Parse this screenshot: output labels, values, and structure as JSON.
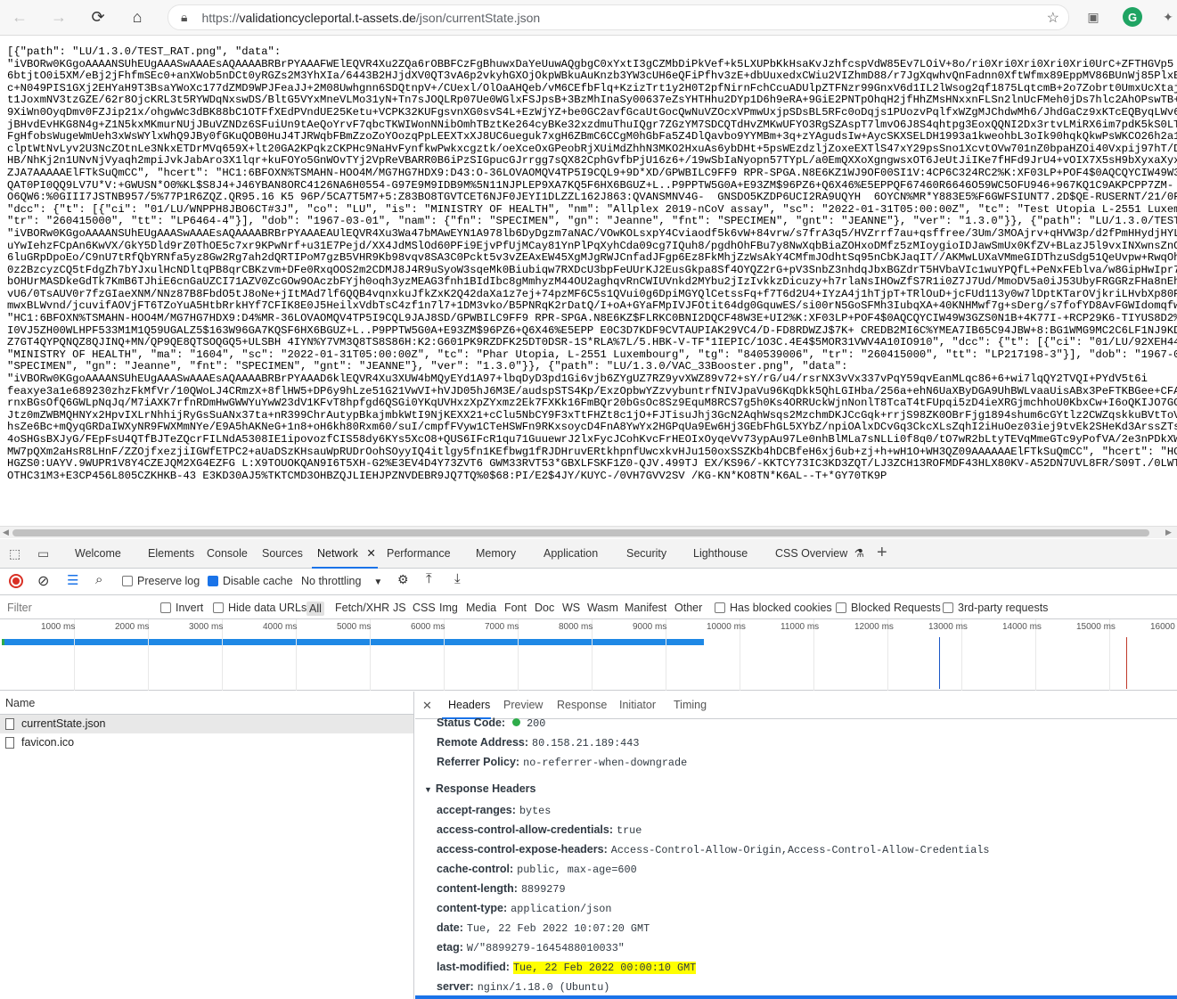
{
  "browser": {
    "url_prefix": "https://",
    "url_host": "validationcycleportal.t-assets.de",
    "url_path": "/json/currentState.json",
    "back_icon": "arrow-left-icon",
    "forward_icon": "arrow-right-icon",
    "reload_icon": "reload-icon",
    "home_icon": "home-icon"
  },
  "json_lines": [
    "[{\"path\": \"LU/1.3.0/TEST_RAT.png\", \"data\":",
    "\"iVBORw0KGgoAAAANSUhEUgAAASwAAAEsAQAAAABRBrPYAAAFWElEQVR4Xu2ZQa6rOBBFCzFgBhuwxDaYeUuwAQgbgC0xYxtI3gCZMbDiPkVef+k5LXUPbKkHsaKvJzhfcspVdW85Ev7LOiV+8o/ri0Xri0Xri0Xri0Xri0UrC+ZFTHGVp5",
    "6btjtO0i5XM/eBj2jFhfmSEc0+anXWob5nDCt0yRGZs2M3YhXIa/6443B2HJjdXV0QT3vA6p2vkyhGXOjOkpWBkuAuKnzb3YW3cUH6eQFiPfhv3zE+dbUuxedxCWiu2VIZhmD88/r7JgXqwhvQnFadnn0XftWfmx89EppMV86BUnWj85PlxEhAQj",
    "c+N049PIS1GXj2EHYaH9T3BsaYWoXc177dZMD9WPJFeaJJ+2M08Uwhgnn6SDQtnpV+/CUexl/OlOaAHQeb/vM6CEfbFlq+KzizTrt1y2H0T2pfNirnFchCcuADUlpZTFNzr99GnxV6d1IL2lWsog2qf1875LqtcmB+2o7Zobrt0UmxUcXtajh5J",
    "t1JoxmNV3tzGZE/62r8OjcKRL3t5RYWDqNxswDS/BltG5VYxMneVLMo31yN+Tn7sJOQLRp07Ue0WGlxFSJpsB+3BzMhInaSy00637eZsYHTHhu2DYp1D6h9eRA+9GiE2PNTpOhqH2jfHhZMsHNxxnFLSn2lnUcFMeh0jDs7hlc2AhOPswTB+lUCD",
    "9XiWn0OyqDmv0FZJip21x/ohgwWc3dBK88bC1OTFfXEdPVndUE25Ketu+VCPK32KUFgsvnXG0svS4L+EzWjYZ+be0GC2avfGcaUtGocQwNuVZOcxVPmwUxjpSDsBL5RFc0oDqjs1PUozvPqlfxWZgMJChdwMh6/JhdGaCz9xKTcEQByqLWv6o+q",
    "jBHvdEvHKG8N4g+Z1N5kxMKmurNUjJBuVZNDz6SFuiUn9tAeQoYrvF7qbcTKWIWonNNibOmhTBztKe264cyBKe32xzdmuThuIQgr7ZGzYM7SDCQTdHvZMKwUFYO3RgSZAspT7lmvO6J8S4qhtpg3EoxQQNI2Dx3rtvLMiRX6im7pdK5kS0LTDss",
    "FgHfobsWugeWmUeh3xWsWYlxWhQ9JBy0fGKuQOB0HuJ4TJRWqbFBmZzoZoYOozqPpLEEXTxXJ8UC6ueguk7xgH6ZBmC6CCgM0hGbFa5Z4DlQavbo9YYMBm+3q+zYAgudsIw+AycSKXSELDH1993a1kweohbL3oIk90hqkQkwPsWKCO26h2a1zuQ",
    "clptWtNvLyv2U3NcZOtnLe3NkxETDrMVq659X+lt20GA2KPqkzCKPHc9NaHvFynfkwPwkxcgztk/oeXceOxGPeobRjXUiMdZhhN3MKO2HxuAs6ybDHt+5psWEzdzljZoxeEXTlS47xY29psSno1XcvtOVw701nZ0bpaHZOi40Vxpij97hT/D+n0H",
    "HB/NhKj2n1UNvNjVyaqh2mpiJvkJabAro3X1lqr+kuFOYo5GnWOvTYj2VpReVBARR0B6iPzSIGpucGJrrgg7sQX82CphGvfbPjU16z6+/19wSbIaNyopn57TYpL/a0EmQXXoXgngwsxOT6JeUtJiIKe7fHFd9JrU4+vOIX7X5sH9bXyxaXyxaXyx",
    "ZJA7AAAAAElFTkSuQmCC\", \"hcert\": \"HC1:6BFOXN%TSMAHN-HOO4M/MG7HG7HDX9:D43:O-36LOVAOMQV4TP5I9CQL9+9D*XD/GPWBILC9FF9 RPR-SPGA.N8E6KZ1WJ9OF00SI1V:4CP6C324RC2%K:XF03LP+POF4$0AQCQYCIW49W3GZS0",
    "QAT0PI0QQ9LV7U*V:+GWUSN*O0%KL$S8J4+J46YBAN8ORC4126NA6H0554-G97E9M9IDB9M%5N11NJPLEP9XA7KQ5F6HX6BGUZ+L..P9PPTW5G0A+E93ZM$96PZ6+Q6X46%E5EPPQF67460R6646O59WC5OFU946+967KQ1C9AKPCPP7ZM-",
    "O6QW6:%0GIII7JSTNB957/5%77P1R6ZQZ.QR95.16 K5 96P/5CA7T5M7+5:Z83BO8TGVTCET6NJF0JEYI1DLZZL162J863:QVANSMNV4G-  GNSDO5KZDP6UCI2RA9UQYH  6OYCN%MR*Y883E5%F6GWFSIUNT7.2D$QE-RUSERNT/21/0FL6O-1",
    "\"dcc\": {\"t\": [{\"ci\": \"01/LU/WNPPH8JBO6CT#3J\", \"co\": \"LU\", \"is\": \"MINISTRY OF HEALTH\", \"nm\": \"Allplex 2019-nCoV assay\", \"sc\": \"2022-01-31T05:00:00Z\", \"tc\": \"Test Utopia L-2551 Luxembour",
    "\"tr\": \"260415000\", \"tt\": \"LP6464-4\"}], \"dob\": \"1967-03-01\", \"nam\": {\"fn\": \"SPECIMEN\", \"gn\": \"Jeanne\", \"fnt\": \"SPECIMEN\", \"gnt\": \"JEANNE\"}, \"ver\": \"1.3.0\"}}, {\"path\": \"LU/1.3.0/TEST_NA",
    "\"iVBORw0KGgoAAAANSUhEUgAAASwAAAEsAQAAAABRBrPYAAAEAUlEQVR4Xu3Wa47bMAwEYN1A978lb6DyDgzm7aNAC/VOwKOLsxpY4Cviaodf5k6vW+84vrw/s7frA3q5/HVZrrf7au+qsffree/3Um/3MOAjrv+qHVW3p/d2fPmHHydjHYLV6cy+",
    "uYwIehzFCpAn6KwVX/GkY5Dld9rZ0ThOE5c7xr9KPwNrf+u31E7Pejd/XX4JdMSlOd60PFi9EjvPfUjMCay81YnPlPqXyhCda09cg7IQuh8/pgdhOhFBu7y8NwXqbBiaZOHxoDMfz5zMIoygioIDJawSmUx0KfZV+BLazJ5l9vxINXwnsZnOMtri",
    "6luGRpDpoEo/C9nU7tRfQbYRNfa5yz8Gw2Rg7ah2dQRTIPoM7gzB5VHR9Kb98vqv8SA3C0Pckt5v3vZEAxEW45XgMJgRWJCnfadJFgp6Ez8FkMhjZzWsAkY4CMfmJOdhtSq95nCbKJaqIT//AKMwLUXaVMmeGIDThzuSdg51QeUvpw+RwqOhyXyf",
    "0z2BzcyzCQ5tFdgZh7bYJxulHcNDltqPB8qrCBKzvm+DFe0RxqOOS2m2CDMJ8J4R9uSyoW3sqeMk0Biubiqw7RXDcU3bpFeUUrKJ2EusGkpa8Sf4OYQZ2rG+pV3SnbZ3nhdqJbxBGZdrT5HVbaVIc1wuYPQfL+PeNxFEblva/w8GipHwIpr7WbPO",
    "bOHUrMASDkeGdTk7KmB6TJhiE6cnGaUZCI71AZV0ZcGOw9OAczbFYjh0oqh3yzMEAG3fnh1BIdIbc8gMmhyzM44OU2aghqvRnCWIUVnkd2MYbu2jIzIvkkzDicuzy+h7rlaNsIHOwZfS7R1i0Z7J7Ud/MmoDV5a0iJ53UbyFRGGRzFHa8nEhupAU",
    "vU6/0TsAUV0r7fzGIaeXNM/NNz87B8FbdO5tJ8oNe+jItMAd7lf6QQB4vqnxkuJfkZxK2Q42daXa1z7ej+74pzMF6C5s1QVui0g6DpiMGYQlCetssFq+f7T6d2U4+IYzA4j1hTjpT+TRlOuD+jcFUd113y0w7lDptKTarOVjkriLHvbXp80Pni3t",
    "mwxBLWvnd/jcuvifAOVjFT6TZoYuA5HtbRrkHYf7CFIK8E0J5HeilxVdbTsC4zf1n7l7+1DM3vko/B5PNRqK2rDatQ/I+oA+GYaFMpIVJFOtit64dg0GquwES/si00rN5GoSFMh3IubqXA+40KNHMwf7g+sDerg/s7fofYD8AvFGWIdomqfwAAAA",
    "\"HC1:6BFOXN%TSMAHN-HOO4M/MG7HG7HDX9:D4%MR-36LOVAOMQV4TP5I9CQL9JAJ8SD/GPWBILC9FF9 RPR-SPGA.N8E6KZ$FLRKC0BNI2DQCF48W3E+UI2%K:XF03LP+POF4$0AQCQYCIW49W3GZS0N1B+4K77I-+RCP29K6-TIYUS8D2%H08L",
    "I0VJ5ZH00WLHPF533M1M1Q59UGALZ5$163W96GA7KQSF6HX6BGUZ+L..P9PPTW5G0A+E93ZM$96PZ6+Q6X46%E5EPP E0C3D7KDF9CVTAUPIAK29VC4/D-FD8RDWZJ$7K+ CREDB2MI6C%YMEA7IB65C94JBW+8:BG1WMG9MC2C6LF1NJ9KD%-BPK",
    "Z7GT4QYPQNQZ8QJINQ+MN/QP9QE8QTSOQGQ5+ULSBH 4IYN%Y7VM3Q8TS8S86H:K2:G601PK9RZDFK25DT0DSR-1S*RLA%7L/5.HBK-V-TF*1IEPIC/1O3C.4E4$5MOR31VWV4A10IO910\", \"dcc\": {\"t\": [{\"ci\": \"01/LU/92XEH4438Q8",
    "\"MINISTRY OF HEALTH\", \"ma\": \"1604\", \"sc\": \"2022-01-31T05:00:00Z\", \"tc\": \"Phar Utopia, L-2551 Luxembourg\", \"tg\": \"840539006\", \"tr\": \"260415000\", \"tt\": \"LP217198-3\"}], \"dob\": \"1967-03-01",
    "\"SPECIMEN\", \"gn\": \"Jeanne\", \"fnt\": \"SPECIMEN\", \"gnt\": \"JEANNE\"}, \"ver\": \"1.3.0\"}}, {\"path\": \"LU/1.3.0/VAC_33Booster.png\", \"data\":",
    "\"iVBORw0KGgoAAAANSUhEUgAAASwAAAEsAQAAAABRBrPYAAAD6klEQVR4Xu3XUW4bMQyEYd1A97+lbqDyD3pd1Gi6vjb6ZYgUZ7RZ9yvXWZ89v72+sY/rG/u4/rsrNX3vVx337vPqY59qvEanMLqc86+6+wi7lqQY2TVQI+PYdV5t6i",
    "feaxye3a1e689230zhzFkMfVr/10QWoLJ4CRmzX+8flHW5+DP6y9hLze51G21VwVI+hVJD05hJ6M3E/audspSTS4Kp/ExzOpbwYZzvybuntrfNIVJpaVu96KqDkk5QhLGIHba/256a+ehN6UaXByDGA9UhBWLvaaUisABx3PeFTKBGee+CFAjjk2",
    "rnxBGsOfQ6GWLpNqJq/M7iAXK7rfnRDmHwGWWYuYwW23dV1KFvT8hpfgd6QSGi0YKqUVHxzXpZYxmz2Ek7FXKk16FmBQr20bGsOc8Sz9EquM8RCS7g5h0Ks4ORRUckWjnNonlT8TcaT4tFUpqi5zD4ieXRGjmchhoU0KbxCw+I6oQKIJO7GGOo5h",
    "Jtz0mZWBMQHNYx2HpvIXLrNhhijRyGsSuANx37ta+nR399ChrAutypBkajmbkWtI9NjKEXX21+cClu5NbCY9F3xTtFHZt8c1jO+FJTisuJhj3GcN2AqhWsqs2MzchmDKJCcGqk+rrjS98ZK0OBrFjg1894shum6cGYtlz2CWZqskkuBVtToVB0C",
    "hsZe6Bc+mQyqGRDaIWXyNR9FWXMmNYe/E9A5hAKNeG+1n8+oH6kh80Rxm60/suI/cmpfFVyw1CTeHSWFn9RKxsoycD4FnA8YwYx2HGPqUa9Ew6Hj3GEbFhGL5XYbZ/npiOAlxDCvGq3CkcXLsZqhI2iHuOez03iej9tvEk2SHeKd3ArssZTsmPN",
    "4oSHGsBXJyG/FEpFsU4QTfBJTeZQcrFILNdA5308IE1ipovozfCIS58dy6KYs5XcO8+QUS6IFcR1qu71GuuewrJ2lxFycJCohKvcFrHEOIxOyqeVv73ypAu97Le0nhBlMLa7sNLLi0f8q0/tO7wR2bLtyTEVqMmeGTc9yPofVA/2e3nPDkXW82cN",
    "MW7pQXm2aHsR8LHnF/ZZOjfxezjiIGWfETPC2+aUaDSzKHsauWpRUDrOohSOyyIQ4itlgy5fn1KEfbwg1fRJDHruvERtkhpnfUwcxkvHJu150oxSSZKb4hDCBfeH6xj6ub+zj+h+wH1O+WH3QZ09AAAAAAElFTkSuQmCC\", \"hcert\": \"HC1:6B",
    "HGZS0:UAYV.9WUPR1V8Y4CZEJQM2XG4EZFG L:X9TOUOKQAN9I6T5XH-G2%E3EV4D4Y73ZVT6 GWM33RVT53*GBXLFSKF1Z0-QJV.499TJ EX/KS96/-KKTCY73IC3KD3ZQT/LJ3ZCH13ROFMDF43HLX80KV-A52DN7UVL8FR/S09T./0LWTKD3",
    "OTHC31M3+E3CP456L805CZKHKB-43 E3KD30AJ5%TKTCMD3OHBZQJLIEHJPZNVDEBR9JQ7TQ%0$68:PI/E2$4JY/KUYC-/0VH7GVV2SV /KG-KN*KO8TN*K6AL--T+*GY70TK9P"
  ],
  "devtools": {
    "tabs": [
      "Welcome",
      "Elements",
      "Console",
      "Sources",
      "Network",
      "Performance",
      "Memory",
      "Application",
      "Security",
      "Lighthouse",
      "CSS Overview"
    ],
    "active_tab": "Network",
    "toolbar": {
      "preserve_log": "Preserve log",
      "disable_cache": "Disable cache",
      "throttling": "No throttling"
    },
    "filter": {
      "placeholder": "Filter",
      "invert": "Invert",
      "hide_data_urls": "Hide data URLs",
      "types": [
        "All",
        "Fetch/XHR",
        "JS",
        "CSS",
        "Img",
        "Media",
        "Font",
        "Doc",
        "WS",
        "Wasm",
        "Manifest",
        "Other"
      ],
      "has_blocked_cookies": "Has blocked cookies",
      "blocked_requests": "Blocked Requests",
      "third_party": "3rd-party requests"
    },
    "timeline_ticks": [
      "1000 ms",
      "2000 ms",
      "3000 ms",
      "4000 ms",
      "5000 ms",
      "6000 ms",
      "7000 ms",
      "8000 ms",
      "9000 ms",
      "10000 ms",
      "11000 ms",
      "12000 ms",
      "13000 ms",
      "14000 ms",
      "15000 ms",
      "16000"
    ],
    "requests_header": "Name",
    "requests": [
      "currentState.json",
      "favicon.ico"
    ],
    "detail_tabs": [
      "Headers",
      "Preview",
      "Response",
      "Initiator",
      "Timing"
    ],
    "general": [
      {
        "k": "Status Code:",
        "v": "200"
      },
      {
        "k": "Remote Address:",
        "v": "80.158.21.189:443"
      },
      {
        "k": "Referrer Policy:",
        "v": "no-referrer-when-downgrade"
      }
    ],
    "response_section": "Response Headers",
    "response_headers": [
      {
        "k": "accept-ranges:",
        "v": "bytes"
      },
      {
        "k": "access-control-allow-credentials:",
        "v": "true"
      },
      {
        "k": "access-control-expose-headers:",
        "v": "Access-Control-Allow-Origin,Access-Control-Allow-Credentials"
      },
      {
        "k": "cache-control:",
        "v": "public, max-age=600"
      },
      {
        "k": "content-length:",
        "v": "8899279"
      },
      {
        "k": "content-type:",
        "v": "application/json"
      },
      {
        "k": "date:",
        "v": "Tue, 22 Feb 2022 10:07:20 GMT"
      },
      {
        "k": "etag:",
        "v": "W/\"8899279-1645488010033\""
      },
      {
        "k": "last-modified:",
        "v": "Tue, 22 Feb 2022 00:00:10 GMT"
      },
      {
        "k": "server:",
        "v": "nginx/1.18.0 (Ubuntu)"
      }
    ]
  }
}
